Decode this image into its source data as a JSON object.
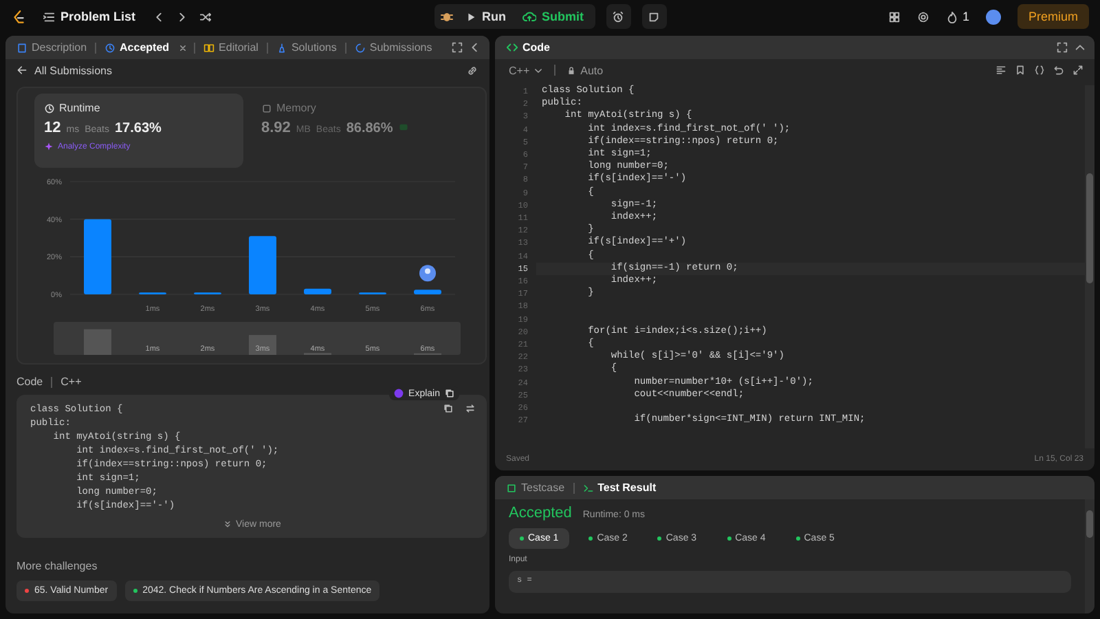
{
  "topbar": {
    "title": "Problem List",
    "run": "Run",
    "submit": "Submit",
    "streak": "1",
    "premium": "Premium"
  },
  "left_panel": {
    "tabs": [
      {
        "label": "Description",
        "kind": "description",
        "selected": false,
        "closable": false
      },
      {
        "label": "Accepted",
        "kind": "accepted",
        "selected": true,
        "closable": true
      },
      {
        "label": "Editorial",
        "kind": "editorial",
        "selected": false,
        "closable": false
      },
      {
        "label": "Solutions",
        "kind": "solutions",
        "selected": false,
        "closable": false
      },
      {
        "label": "Submissions",
        "kind": "submissions",
        "selected": false,
        "closable": false
      }
    ],
    "back_link": "All Submissions",
    "stats": [
      {
        "label": "Runtime",
        "kind": "runtime",
        "selected": true,
        "value": "12",
        "unit": "ms",
        "beats_label": "Beats",
        "beats": "17.63%"
      },
      {
        "label": "Memory",
        "kind": "memory",
        "selected": false,
        "value": "8.92",
        "unit": "MB",
        "beats_label": "Beats",
        "beats": "86.86%"
      }
    ],
    "analyze": "Analyze Complexity",
    "chart_data": {
      "type": "bar",
      "categories": [
        null,
        "1ms",
        "2ms",
        "3ms",
        "4ms",
        "5ms",
        "6ms"
      ],
      "values": [
        40,
        1,
        1,
        31,
        3,
        1,
        2.5
      ],
      "ylim": [
        0,
        60
      ],
      "yticks": [
        {
          "value": 0,
          "label": "0%"
        },
        {
          "value": 20,
          "label": "20%"
        },
        {
          "value": 40,
          "label": "40%"
        },
        {
          "value": 60,
          "label": "60%"
        }
      ]
    },
    "brush_labels": [
      "1ms",
      "2ms",
      "3ms",
      "4ms",
      "5ms",
      "6ms"
    ],
    "code": {
      "label": "Code",
      "language": "C++",
      "explain": "Explain",
      "view_more": "View more",
      "lines": [
        "class Solution {",
        "public:",
        "    int myAtoi(string s) {",
        "        int index=s.find_first_not_of(' ');",
        "        if(index==string::npos) return 0;",
        "        int sign=1;",
        "        long number=0;",
        "        if(s[index]=='-')"
      ]
    },
    "more_challenges": {
      "title": "More challenges",
      "items": [
        {
          "label": "65. Valid Number",
          "color": "#ef4444"
        },
        {
          "label": "2042. Check if Numbers Are Ascending in a Sentence",
          "color": "#22c55e"
        }
      ]
    }
  },
  "code_panel": {
    "title": "Code",
    "language": "C++",
    "mode": "Auto",
    "status": "Saved",
    "position": "Ln 15, Col 23",
    "lines": [
      {
        "n": "1",
        "text": "class Solution {",
        "current": false
      },
      {
        "n": "2",
        "text": "public:",
        "current": false
      },
      {
        "n": "3",
        "text": "    int myAtoi(string s) {",
        "current": false
      },
      {
        "n": "4",
        "text": "        int index=s.find_first_not_of(' ');",
        "current": false
      },
      {
        "n": "5",
        "text": "        if(index==string::npos) return 0;",
        "current": false
      },
      {
        "n": "6",
        "text": "        int sign=1;",
        "current": false
      },
      {
        "n": "7",
        "text": "        long number=0;",
        "current": false
      },
      {
        "n": "8",
        "text": "        if(s[index]=='-')",
        "current": false
      },
      {
        "n": "9",
        "text": "        {",
        "current": false
      },
      {
        "n": "10",
        "text": "            sign=-1;",
        "current": false
      },
      {
        "n": "11",
        "text": "            index++;",
        "current": false
      },
      {
        "n": "12",
        "text": "        }",
        "current": false
      },
      {
        "n": "13",
        "text": "        if(s[index]=='+')",
        "current": false
      },
      {
        "n": "14",
        "text": "        {",
        "current": false
      },
      {
        "n": "15",
        "text": "            if(sign==-1) return 0;",
        "current": true
      },
      {
        "n": "16",
        "text": "            index++;",
        "current": false
      },
      {
        "n": "17",
        "text": "        }",
        "current": false
      },
      {
        "n": "18",
        "current": false
      },
      {
        "n": "19",
        "current": false
      },
      {
        "n": "20",
        "text": "        for(int i=index;i<s.size();i++)",
        "current": false
      },
      {
        "n": "21",
        "text": "        {",
        "current": false
      },
      {
        "n": "22",
        "text": "            while( s[i]>='0' && s[i]<='9')",
        "current": false
      },
      {
        "n": "23",
        "text": "            {",
        "current": false
      },
      {
        "n": "24",
        "text": "                number=number*10+ (s[i++]-'0');",
        "current": false
      },
      {
        "n": "25",
        "text": "                cout<<number<<endl;",
        "current": false
      },
      {
        "n": "26",
        "current": false
      },
      {
        "n": "27",
        "text": "                if(number*sign<=INT_MIN) return INT_MIN;",
        "current": false
      }
    ]
  },
  "test_panel": {
    "tabs": [
      {
        "label": "Testcase",
        "kind": "testcase",
        "selected": false
      },
      {
        "label": "Test Result",
        "kind": "result",
        "selected": true
      }
    ],
    "verdict": "Accepted",
    "runtime": "Runtime: 0 ms",
    "cases": [
      {
        "label": "Case 1",
        "selected": true
      },
      {
        "label": "Case 2",
        "selected": false
      },
      {
        "label": "Case 3",
        "selected": false
      },
      {
        "label": "Case 4",
        "selected": false
      },
      {
        "label": "Case 5",
        "selected": false
      }
    ],
    "input_label": "Input",
    "input_value": "s ="
  }
}
